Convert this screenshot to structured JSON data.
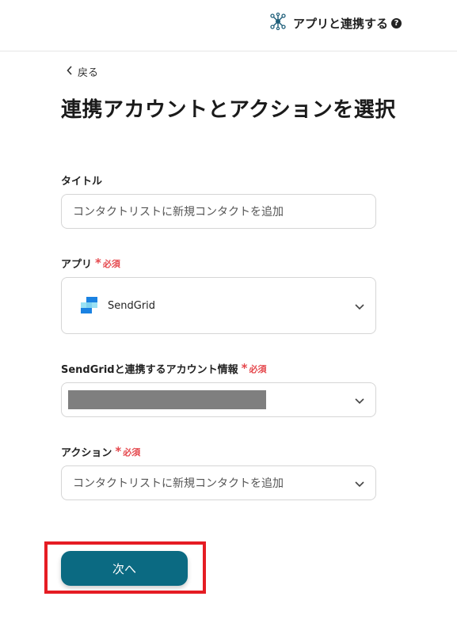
{
  "header": {
    "connect_label": "アプリと連携する",
    "help_glyph": "?",
    "icons": {
      "connect": "network-nodes-icon",
      "help": "question-circle-icon"
    }
  },
  "nav": {
    "back_label": "戻る",
    "back_icon": "chevron-left-icon"
  },
  "page": {
    "title": "連携アカウントとアクションを選択"
  },
  "form": {
    "title_field": {
      "label": "タイトル",
      "value": "コンタクトリストに新規コンタクトを追加"
    },
    "app_field": {
      "label": "アプリ",
      "required": "必須",
      "value": "SendGrid",
      "logo": "sendgrid-logo"
    },
    "account_field": {
      "label": "SendGridと連携するアカウント情報",
      "required": "必須",
      "value_redacted": true
    },
    "action_field": {
      "label": "アクション",
      "required": "必須",
      "value": "コンタクトリストに新規コンタクトを追加"
    }
  },
  "actions": {
    "next_label": "次へ"
  },
  "colors": {
    "primary": "#0b6a82",
    "required": "#e5484d",
    "highlight": "#e51c23",
    "sendgrid_blue": "#1a82e2",
    "sendgrid_light": "#99e1f4"
  }
}
